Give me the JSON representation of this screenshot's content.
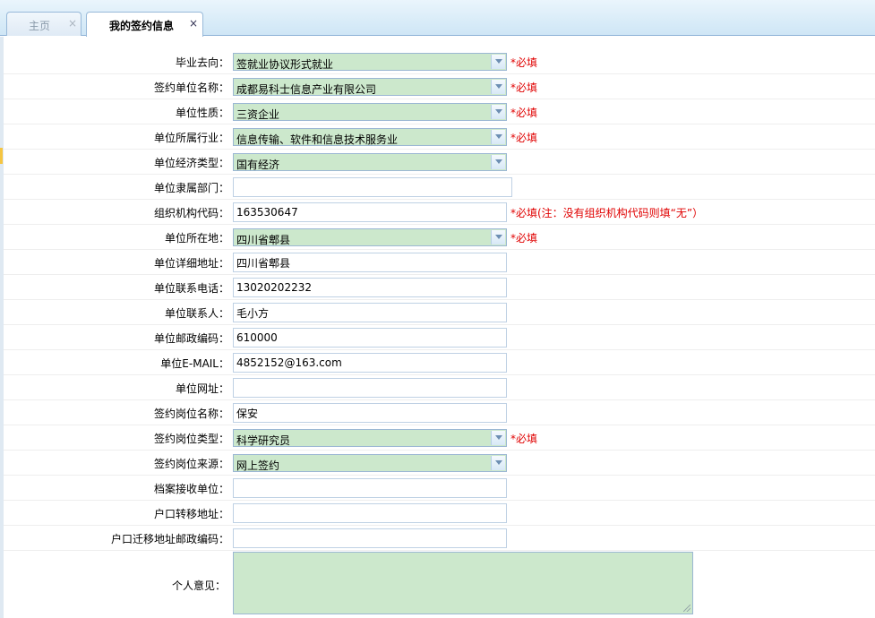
{
  "tabs": [
    {
      "label": "主页",
      "close": "×"
    },
    {
      "label": "我的签约信息",
      "close": "×"
    }
  ],
  "required_text": "*必填",
  "org_code_note": "*必填(注：没有组织机构代码则填“无”）",
  "form": {
    "graduation_direction": {
      "label": "毕业去向：",
      "value": "签就业协议形式就业"
    },
    "employer_name": {
      "label": "签约单位名称：",
      "value": "成都易科士信息产业有限公司"
    },
    "employer_nature": {
      "label": "单位性质：",
      "value": "三资企业"
    },
    "employer_industry": {
      "label": "单位所属行业：",
      "value": "信息传输、软件和信息技术服务业"
    },
    "economic_type": {
      "label": "单位经济类型：",
      "value": "国有经济"
    },
    "affiliated_department": {
      "label": "单位隶属部门：",
      "value": ""
    },
    "org_code": {
      "label": "组织机构代码：",
      "value": "163530647"
    },
    "location": {
      "label": "单位所在地：",
      "value": "四川省郫县"
    },
    "address": {
      "label": "单位详细地址：",
      "value": "四川省郫县"
    },
    "phone": {
      "label": "单位联系电话：",
      "value": "13020202232"
    },
    "contact": {
      "label": "单位联系人：",
      "value": "毛小方"
    },
    "postcode": {
      "label": "单位邮政编码：",
      "value": "610000"
    },
    "email": {
      "label": "单位E-MAIL：",
      "value": "4852152@163.com"
    },
    "website": {
      "label": "单位网址：",
      "value": ""
    },
    "position_name": {
      "label": "签约岗位名称：",
      "value": "保安"
    },
    "position_type": {
      "label": "签约岗位类型：",
      "value": "科学研究员"
    },
    "position_source": {
      "label": "签约岗位来源：",
      "value": "网上签约"
    },
    "archive_unit": {
      "label": "档案接收单位：",
      "value": ""
    },
    "hukou_address": {
      "label": "户口转移地址：",
      "value": ""
    },
    "hukou_postcode": {
      "label": "户口迁移地址邮政编码：",
      "value": ""
    },
    "opinion": {
      "label": "个人意见：",
      "value": ""
    }
  },
  "colors": {
    "select_bg": "#cce8cc",
    "required": "#e00000",
    "tab_border": "#98b9d9"
  }
}
